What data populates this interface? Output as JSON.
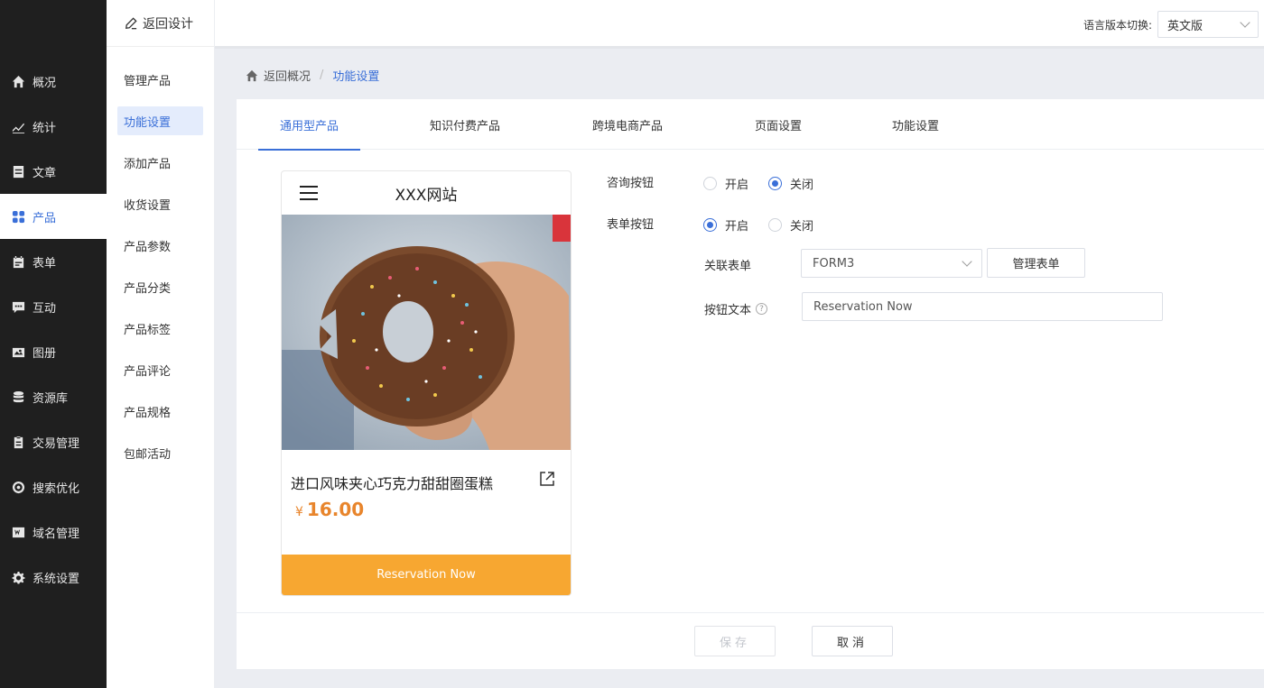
{
  "sidebar": {
    "items": [
      {
        "label": "概况",
        "icon": "home-icon"
      },
      {
        "label": "统计",
        "icon": "chart-icon"
      },
      {
        "label": "文章",
        "icon": "article-icon"
      },
      {
        "label": "产品",
        "icon": "grid-icon"
      },
      {
        "label": "表单",
        "icon": "calendar-icon"
      },
      {
        "label": "互动",
        "icon": "chat-icon"
      },
      {
        "label": "图册",
        "icon": "album-icon"
      },
      {
        "label": "资源库",
        "icon": "database-icon"
      },
      {
        "label": "交易管理",
        "icon": "clipboard-icon"
      },
      {
        "label": "搜索优化",
        "icon": "target-icon"
      },
      {
        "label": "域名管理",
        "icon": "domain-icon"
      },
      {
        "label": "系统设置",
        "icon": "gear-icon"
      }
    ],
    "active_index": 3
  },
  "subside": {
    "back_label": "返回设计",
    "items": [
      "管理产品",
      "功能设置",
      "添加产品",
      "收货设置",
      "产品参数",
      "产品分类",
      "产品标签",
      "产品评论",
      "产品规格",
      "包邮活动"
    ],
    "active_index": 1
  },
  "header": {
    "lang_label": "语言版本切换:",
    "lang_value": "英文版"
  },
  "breadcrumb": {
    "home": "返回概况",
    "current": "功能设置"
  },
  "tabs": [
    "通用型产品",
    "知识付费产品",
    "跨境电商产品",
    "页面设置",
    "功能设置"
  ],
  "preview": {
    "site_title": "XXX网站",
    "product_title": "进口风味夹心巧克力甜甜圈蛋糕",
    "currency": "¥",
    "price": "16.00",
    "cta": "Reservation Now"
  },
  "form": {
    "consult_label": "咨询按钮",
    "consult_on": "开启",
    "consult_off": "关闭",
    "consult_value": "off",
    "form_label": "表单按钮",
    "form_on": "开启",
    "form_off": "关闭",
    "form_value": "on",
    "link_form_label": "关联表单",
    "link_form_value": "FORM3",
    "manage_form": "管理表单",
    "btn_text_label": "按钮文本",
    "btn_text_value": "Reservation Now"
  },
  "footer": {
    "save": "保存",
    "cancel": "取消"
  },
  "colors": {
    "accent": "#3a6fd8",
    "cta": "#f7a731",
    "price": "#e8852c"
  }
}
